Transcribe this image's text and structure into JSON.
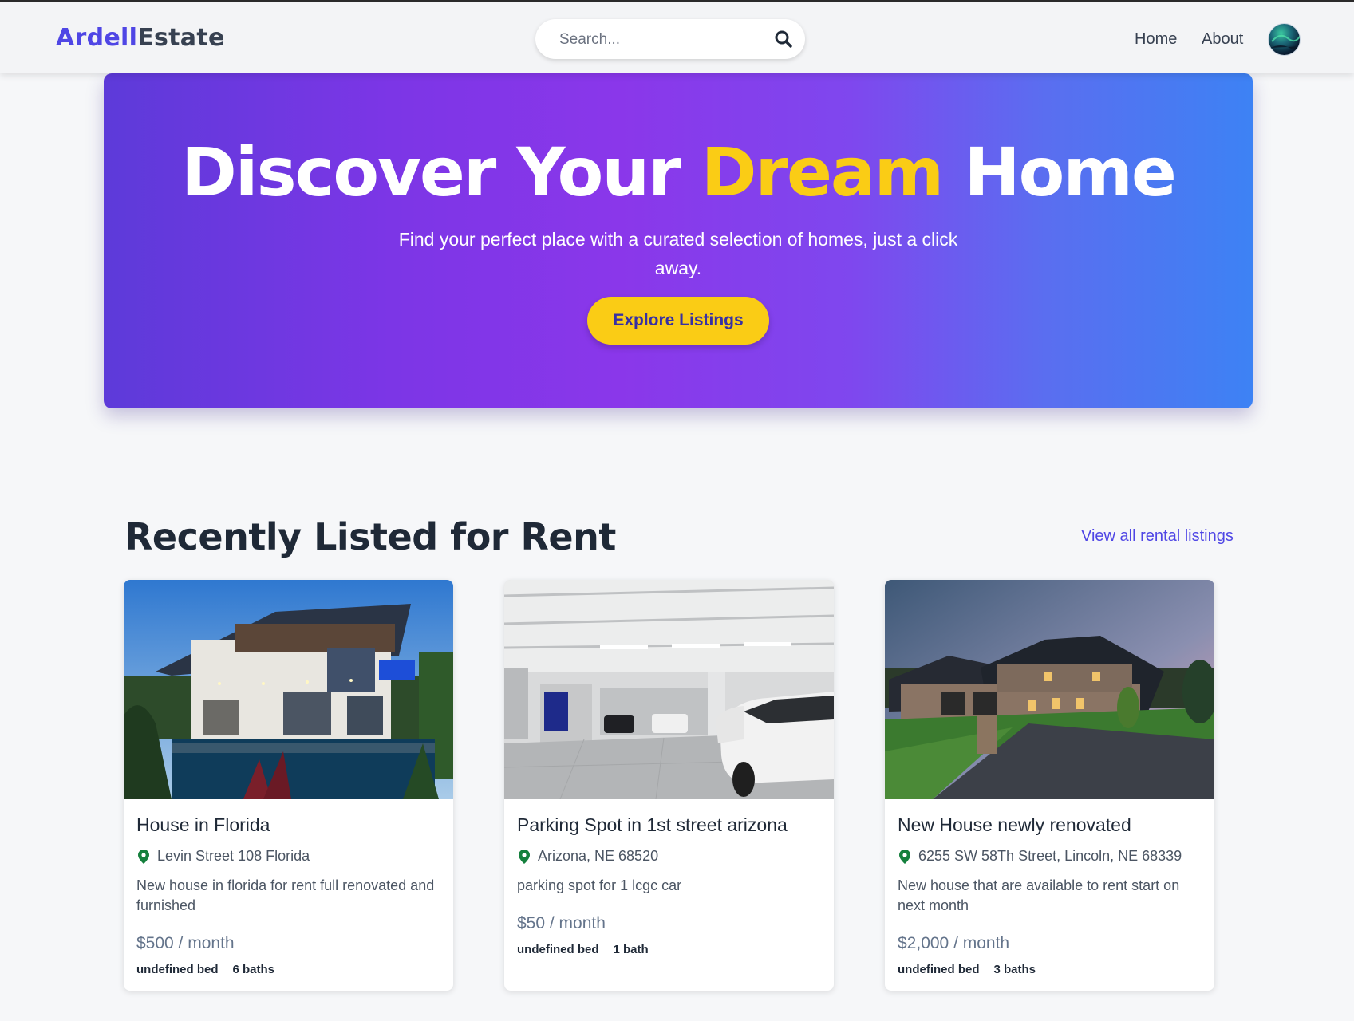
{
  "header": {
    "logo_part1": "Ardell",
    "logo_part2": "Estate",
    "search_placeholder": "Search...",
    "nav": {
      "home": "Home",
      "about": "About"
    },
    "icons": {
      "search": "search-icon",
      "avatar": "user-avatar"
    }
  },
  "hero": {
    "title_before": "Discover Your ",
    "title_highlight": "Dream",
    "title_after": " Home",
    "subtitle": "Find your perfect place with a curated selection of homes, just a click away.",
    "button_label": "Explore Listings",
    "colors": {
      "highlight": "#facc15",
      "gradient_start": "#5d3ad9",
      "gradient_mid": "#8a37ea",
      "gradient_end": "#3d82f4"
    }
  },
  "rent_section": {
    "title": "Recently Listed for Rent",
    "view_all": "View all rental listings",
    "listings": [
      {
        "title": "House in Florida",
        "location": "Levin Street 108 Florida",
        "description": "New house in florida for rent full renovated and furnished",
        "price": "$500 / month",
        "beds": "undefined bed",
        "baths": "6 baths",
        "image": "modern-house-with-pool-photo"
      },
      {
        "title": "Parking Spot in 1st street arizona",
        "location": "Arizona, NE 68520",
        "description": "parking spot for 1 lcgc car",
        "price": "$50 / month",
        "beds": "undefined bed",
        "baths": "1 bath",
        "image": "underground-parking-garage-photo"
      },
      {
        "title": "New House newly renovated",
        "location": "6255 SW 58Th Street, Lincoln, NE 68339",
        "description": "New house that are available to rent start on next month",
        "price": "$2,000 / month",
        "beds": "undefined bed",
        "baths": "3 baths",
        "image": "stone-house-at-dusk-photo"
      }
    ]
  },
  "colors": {
    "brand": "#4f46e5",
    "pin": "#15803d",
    "text": "#1f2937"
  }
}
